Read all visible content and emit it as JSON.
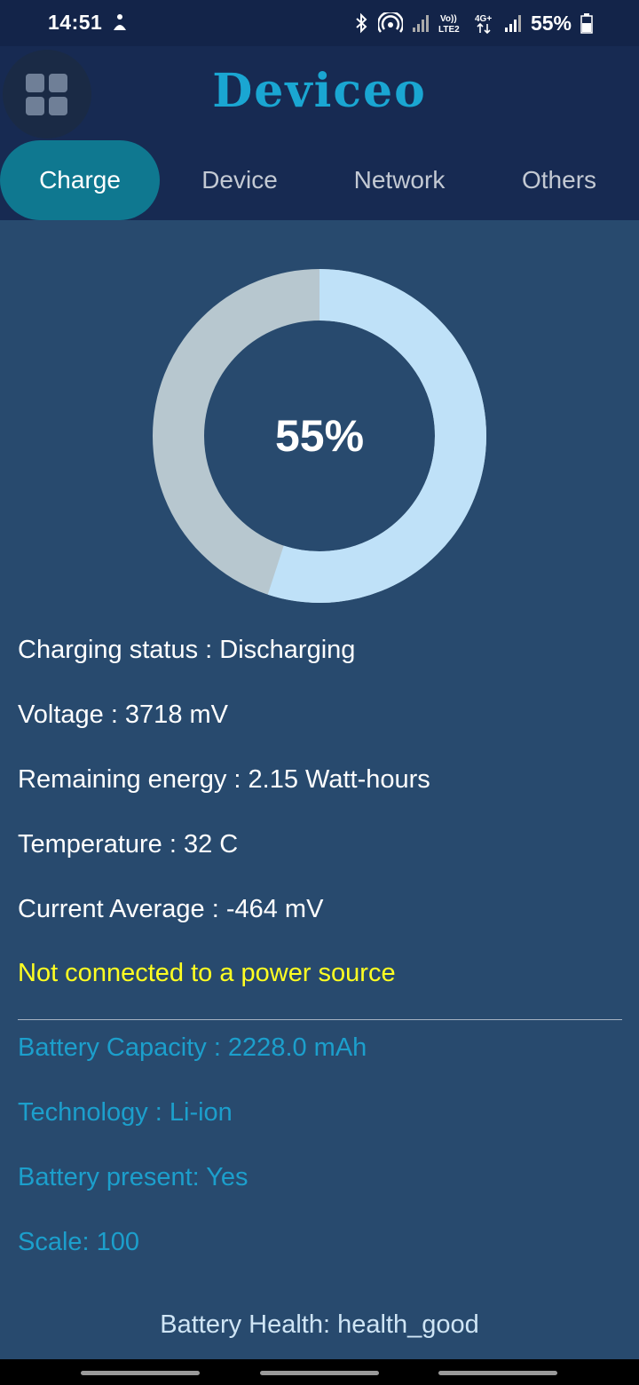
{
  "status_bar": {
    "time": "14:51",
    "battery_percent": "55%",
    "network_labels": [
      "Vo)) LTE2",
      "4G+"
    ]
  },
  "app": {
    "title": "Deviceo",
    "menu_icon": "grid-icon",
    "accent_color": "#1aa6d2"
  },
  "tabs": [
    {
      "label": "Charge",
      "active": true
    },
    {
      "label": "Device",
      "active": false
    },
    {
      "label": "Network",
      "active": false
    },
    {
      "label": "Others",
      "active": false
    }
  ],
  "battery_ring": {
    "label": "55%",
    "level": 0.55,
    "filled_color": "#bfe1f8",
    "empty_color": "#b7c7cf"
  },
  "stats": {
    "charging_status": "Charging status : Discharging",
    "voltage": "Voltage : 3718 mV",
    "remaining_energy": "Remaining energy : 2.15 Watt-hours",
    "temperature": "Temperature : 32 C",
    "current_average": "Current Average : -464 mV",
    "power_source": "Not connected to a power source"
  },
  "details": {
    "capacity": "Battery Capacity : 2228.0 mAh",
    "technology": "Technology : Li-ion",
    "present": "Battery present: Yes",
    "scale": "Scale: 100"
  },
  "health": "Battery Health: health_good"
}
